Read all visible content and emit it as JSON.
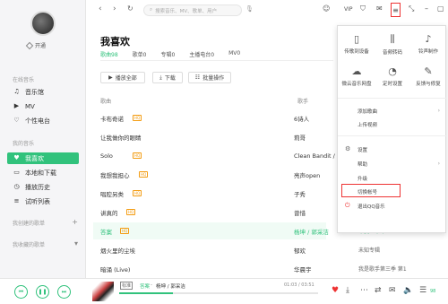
{
  "sidebar": {
    "vip_label": "开通",
    "groups": [
      "在线音乐",
      "我的音乐",
      "我创建的歌单",
      "我收藏的歌单"
    ],
    "items": [
      {
        "label": "音乐馆",
        "icon": "music-hall-icon",
        "glyph": "♫"
      },
      {
        "label": "MV",
        "icon": "mv-icon",
        "glyph": "▶"
      },
      {
        "label": "个性电台",
        "icon": "radio-icon",
        "glyph": "♡"
      },
      {
        "label": "我喜欢",
        "icon": "heart-icon",
        "glyph": "♥"
      },
      {
        "label": "本地和下载",
        "icon": "computer-icon",
        "glyph": "▭"
      },
      {
        "label": "播放历史",
        "icon": "history-icon",
        "glyph": "◷"
      },
      {
        "label": "试听列表",
        "icon": "list-icon",
        "glyph": "≡"
      }
    ]
  },
  "topbar": {
    "search_placeholder": "搜索音乐、MV、歌单、用户",
    "vip": "VIP"
  },
  "main": {
    "title": "我喜欢",
    "tabs": [
      "歌曲98",
      "歌单0",
      "专辑0",
      "主播电台0",
      "MV0"
    ],
    "actions": [
      "播放全部",
      "下载",
      "批量操作"
    ],
    "columns": {
      "song": "歌曲",
      "artist": "歌手"
    },
    "rows": [
      {
        "title": "卡布奇诺",
        "hq": "HQ",
        "artist": "6诗人",
        "album": ""
      },
      {
        "title": "让我做你的眼睛",
        "hq": "",
        "artist": "莉哥",
        "album": ""
      },
      {
        "title": "Solo",
        "hq": "HQ",
        "artist": "Clean Bandit / Dem",
        "album": ""
      },
      {
        "title": "我想我担心",
        "hq": "HQ",
        "artist": "亮声open",
        "album": ""
      },
      {
        "title": "唱腔另类",
        "hq": "HQ",
        "artist": "子秀",
        "album": ""
      },
      {
        "title": "讲真的",
        "hq": "HQ",
        "artist": "曾惜",
        "album": "讲真的"
      },
      {
        "title": "答案",
        "hq": "HQ",
        "artist": "杨坤 / 郭采洁",
        "album": "牛皮二十年"
      },
      {
        "title": "烟火里的尘埃",
        "hq": "",
        "artist": "郁欢",
        "album": "未知专辑"
      },
      {
        "title": "暗涌 (Live)",
        "hq": "",
        "artist": "华晨宇",
        "album": "我是歌手第三季 第1"
      }
    ]
  },
  "menu": {
    "grid": [
      {
        "label": "传歌到设备",
        "icon": "phone-icon",
        "glyph": "▯"
      },
      {
        "label": "音频转码",
        "icon": "audio-wave-icon",
        "glyph": "⫼"
      },
      {
        "label": "铃声制作",
        "icon": "bell-icon",
        "glyph": "♪"
      },
      {
        "label": "微云音乐网盘",
        "icon": "cloud-icon",
        "glyph": "☁"
      },
      {
        "label": "定时设置",
        "icon": "clock-icon",
        "glyph": "◔"
      },
      {
        "label": "反馈与修复",
        "icon": "wrench-icon",
        "glyph": "✎"
      }
    ],
    "items": [
      {
        "label": "添加歌曲",
        "has_sub": true
      },
      {
        "label": "上传视频",
        "has_sub": false
      },
      {
        "label": "设置",
        "has_sub": false
      },
      {
        "label": "帮助",
        "has_sub": true
      },
      {
        "label": "升级",
        "has_sub": false
      },
      {
        "label": "切换帐号",
        "has_sub": false
      },
      {
        "label": "退出QQ音乐",
        "has_sub": false
      }
    ]
  },
  "player": {
    "tag1": "标准",
    "song": "答案",
    "artist": "杨坤 / 郭采洁",
    "time": "01:03 / 03:51",
    "progress": 0.27,
    "count": "98"
  },
  "colors": {
    "accent": "#31c27c",
    "highlight": "#e33333"
  }
}
